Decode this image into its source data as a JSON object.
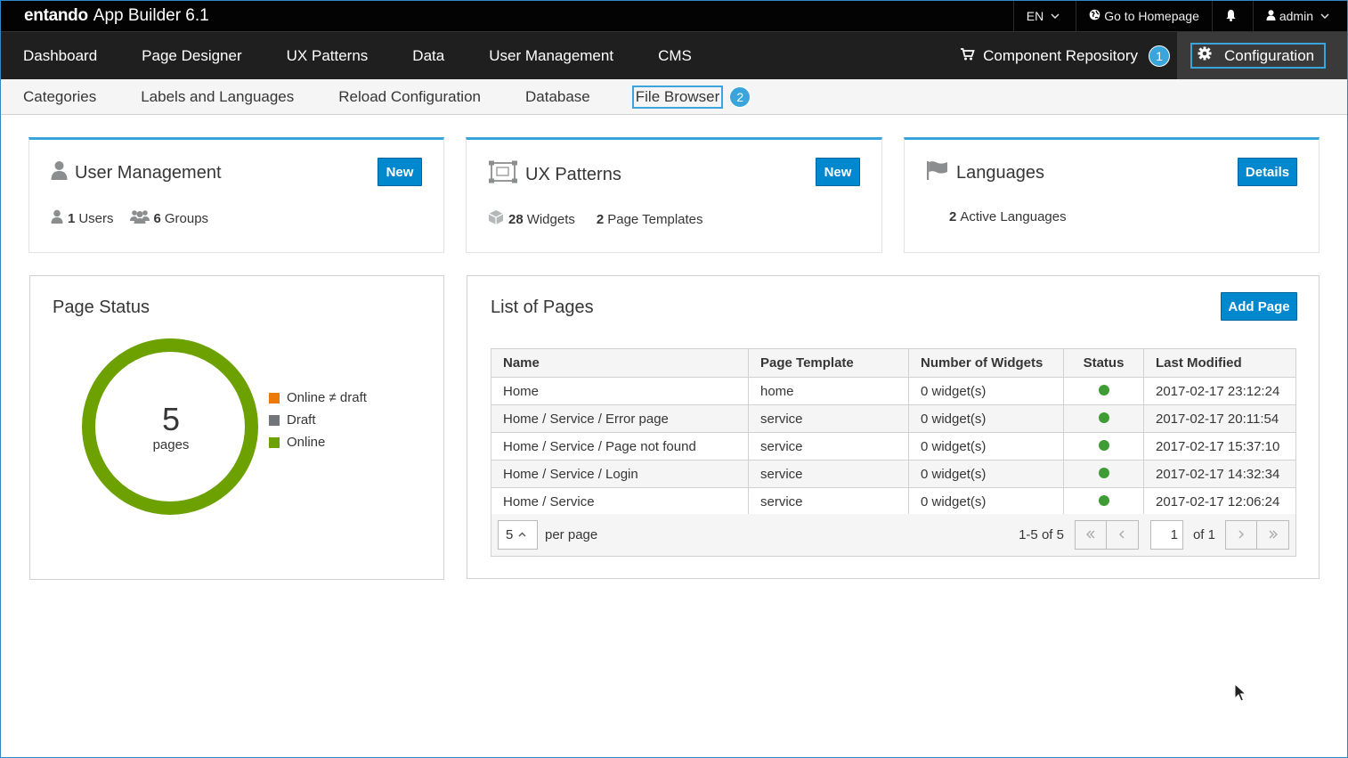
{
  "topbar": {
    "logo": "entando",
    "app_name": "App Builder 6.1",
    "language": "EN",
    "homepage_link": "Go to Homepage",
    "user": "admin"
  },
  "mainnav": {
    "items": [
      "Dashboard",
      "Page Designer",
      "UX Patterns",
      "Data",
      "User Management",
      "CMS"
    ],
    "component_repository": "Component Repository",
    "step1": "1",
    "configuration": "Configuration"
  },
  "subnav": {
    "items": [
      "Categories",
      "Labels and Languages",
      "Reload Configuration",
      "Database"
    ],
    "selected": "File Browser",
    "step2": "2"
  },
  "cards": {
    "user_management": {
      "title": "User Management",
      "button": "New",
      "users_count": "1",
      "users_label": "Users",
      "groups_count": "6",
      "groups_label": "Groups"
    },
    "ux_patterns": {
      "title": "UX Patterns",
      "button": "New",
      "widgets_count": "28",
      "widgets_label": "Widgets",
      "templates_count": "2",
      "templates_label": "Page Templates"
    },
    "languages": {
      "title": "Languages",
      "button": "Details",
      "active_count": "2",
      "active_label": "Active Languages"
    }
  },
  "page_status": {
    "title": "Page Status",
    "total": "5",
    "total_label": "pages",
    "legend": [
      "Online ≠ draft",
      "Draft",
      "Online"
    ],
    "colors": {
      "online_draft": "#ec7a08",
      "draft": "#72767b",
      "online": "#6ca100"
    }
  },
  "pages": {
    "title": "List of Pages",
    "add_button": "Add Page",
    "columns": [
      "Name",
      "Page Template",
      "Number of Widgets",
      "Status",
      "Last Modified"
    ],
    "rows": [
      {
        "name": "Home",
        "template": "home",
        "widgets": "0 widget(s)",
        "modified": "2017-02-17 23:12:24"
      },
      {
        "name": "Home / Service / Error page",
        "template": "service",
        "widgets": "0 widget(s)",
        "modified": "2017-02-17 20:11:54"
      },
      {
        "name": "Home / Service / Page not found",
        "template": "service",
        "widgets": "0 widget(s)",
        "modified": "2017-02-17 15:37:10"
      },
      {
        "name": "Home / Service / Login",
        "template": "service",
        "widgets": "0 widget(s)",
        "modified": "2017-02-17 14:32:34"
      },
      {
        "name": "Home / Service",
        "template": "service",
        "widgets": "0 widget(s)",
        "modified": "2017-02-17 12:06:24"
      }
    ],
    "pager": {
      "per_page_value": "5",
      "per_page_label": "per page",
      "range": "1-5 of 5",
      "current_page": "1",
      "of_pages": "of 1"
    }
  }
}
